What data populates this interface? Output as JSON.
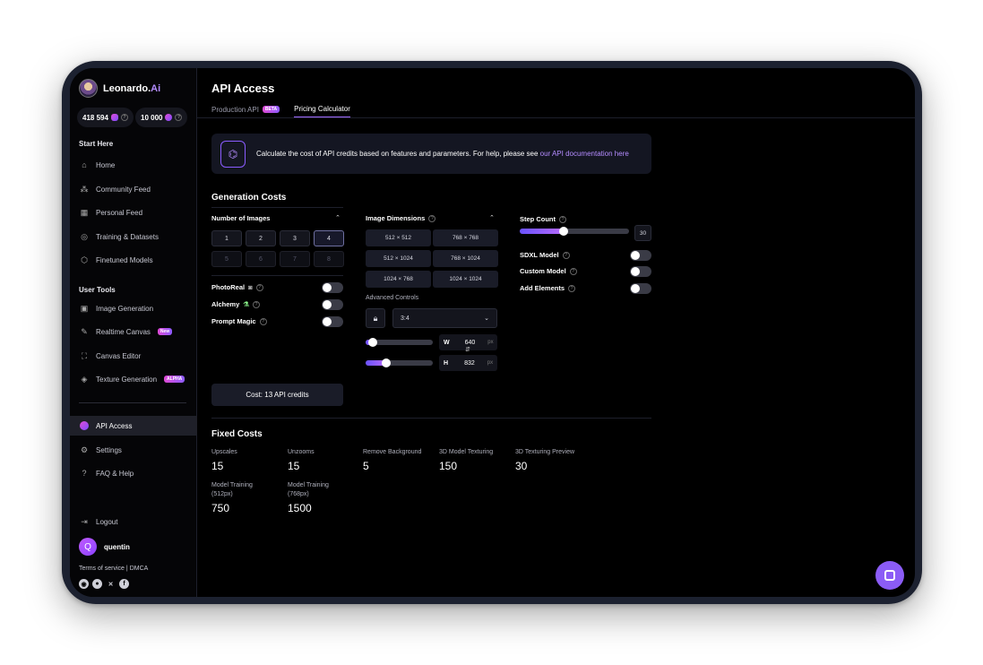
{
  "app": {
    "brand": "Leonardo.",
    "brand_suffix": "Ai"
  },
  "credits": [
    {
      "value": "418 594"
    },
    {
      "value": "10 000"
    }
  ],
  "sidebar": {
    "start_here": "Start Here",
    "start_items": [
      {
        "label": "Home",
        "icon": "home-icon"
      },
      {
        "label": "Community Feed",
        "icon": "community-icon"
      },
      {
        "label": "Personal Feed",
        "icon": "grid-icon"
      },
      {
        "label": "Training & Datasets",
        "icon": "training-icon"
      },
      {
        "label": "Finetuned Models",
        "icon": "cube-icon"
      }
    ],
    "user_tools": "User Tools",
    "tool_items": [
      {
        "label": "Image Generation",
        "icon": "image-icon"
      },
      {
        "label": "Realtime Canvas",
        "icon": "brush-icon",
        "badge": "New"
      },
      {
        "label": "Canvas Editor",
        "icon": "canvas-icon"
      },
      {
        "label": "Texture Generation",
        "icon": "texture-icon",
        "badge": "ALPHA"
      }
    ],
    "bottom_items": [
      {
        "label": "API Access",
        "icon": "api-icon"
      },
      {
        "label": "Settings",
        "icon": "gear-icon"
      },
      {
        "label": "FAQ & Help",
        "icon": "help-icon"
      }
    ],
    "logout": "Logout",
    "user_initial": "Q",
    "username": "quentin",
    "terms": "Terms of service",
    "dmca": "DMCA"
  },
  "page": {
    "title": "API Access",
    "tabs": [
      {
        "label": "Production API",
        "badge": "BETA"
      },
      {
        "label": "Pricing Calculator"
      }
    ],
    "info_text": "Calculate the cost of API credits based on features and parameters. For help, please see ",
    "info_link": "our API documentation here"
  },
  "generation": {
    "heading": "Generation Costs",
    "num_images_label": "Number of Images",
    "num_images": [
      "1",
      "2",
      "3",
      "4",
      "5",
      "6",
      "7",
      "8"
    ],
    "selected_images": "4",
    "toggles_left": [
      {
        "label": "PhotoReal"
      },
      {
        "label": "Alchemy"
      },
      {
        "label": "Prompt Magic"
      }
    ],
    "dims_label": "Image Dimensions",
    "dims": [
      "512 × 512",
      "768 × 768",
      "512 × 1024",
      "768 × 1024",
      "1024 × 768",
      "1024 × 1024"
    ],
    "advanced_label": "Advanced Controls",
    "aspect": "3:4",
    "width_label": "W",
    "width": "640",
    "height_label": "H",
    "height": "832",
    "unit": "px",
    "step_label": "Step Count",
    "step_value": "30",
    "toggles_right": [
      {
        "label": "SDXL Model"
      },
      {
        "label": "Custom Model"
      },
      {
        "label": "Add Elements"
      }
    ],
    "cost": "Cost: 13 API credits"
  },
  "fixed": {
    "heading": "Fixed Costs",
    "items": [
      {
        "label": "Upscales",
        "value": "15"
      },
      {
        "label": "Unzooms",
        "value": "15"
      },
      {
        "label": "Remove Background",
        "value": "5"
      },
      {
        "label": "3D Model Texturing",
        "value": "150"
      },
      {
        "label": "3D Texturing Preview",
        "value": "30"
      },
      {
        "label": "Model Training (512px)",
        "value": "750"
      },
      {
        "label": "Model Training (768px)",
        "value": "1500"
      }
    ]
  }
}
